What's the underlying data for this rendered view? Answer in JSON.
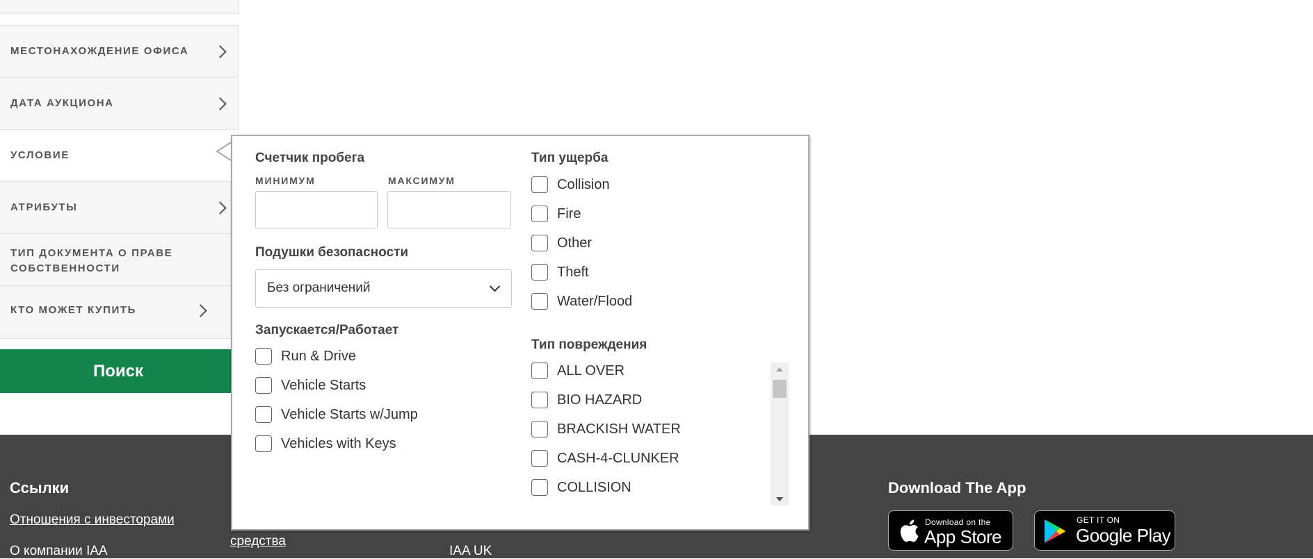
{
  "sidebar": {
    "items": [
      {
        "label": "МЕСТОНАХОЖДЕНИЕ ОФИСА"
      },
      {
        "label": "ДАТА АУКЦИОНА"
      },
      {
        "label": "УСЛОВИЕ"
      },
      {
        "label": "АТРИБУТЫ"
      },
      {
        "label_line1": "ТИП ДОКУМЕНТА О ПРАВЕ",
        "label_line2": "СОБСТВЕННОСТИ"
      },
      {
        "label": "КТО МОЖЕТ КУПИТЬ"
      }
    ],
    "search_label": "Поиск"
  },
  "panel": {
    "odometer": {
      "title": "Счетчик пробега",
      "min_label": "МИНИМУМ",
      "max_label": "МАКСИМУМ",
      "min_value": "",
      "max_value": ""
    },
    "airbags": {
      "title": "Подушки безопасности",
      "selected": "Без ограничений"
    },
    "runs": {
      "title": "Запускается/Работает",
      "options": [
        "Run & Drive",
        "Vehicle Starts",
        "Vehicle Starts w/Jump",
        "Vehicles with Keys"
      ]
    },
    "loss_type": {
      "title": "Тип ущерба",
      "options": [
        "Collision",
        "Fire",
        "Other",
        "Theft",
        "Water/Flood"
      ]
    },
    "damage_type": {
      "title": "Тип повреждения",
      "options": [
        "ALL OVER",
        "BIO HAZARD",
        "BRACKISH WATER",
        "CASH-4-CLUNKER",
        "COLLISION"
      ]
    }
  },
  "footer": {
    "links_title": "Ссылки",
    "link_investors": "Отношения с инвесторами",
    "link_about": "О компании IAA",
    "link_vehicles": "средства",
    "iaa_uk": "IAA UK",
    "app_title": "Download The App",
    "appstore_small": "Download on the",
    "appstore_big": "App Store",
    "googleplay_small": "GET IT ON",
    "googleplay_big": "Google Play"
  }
}
